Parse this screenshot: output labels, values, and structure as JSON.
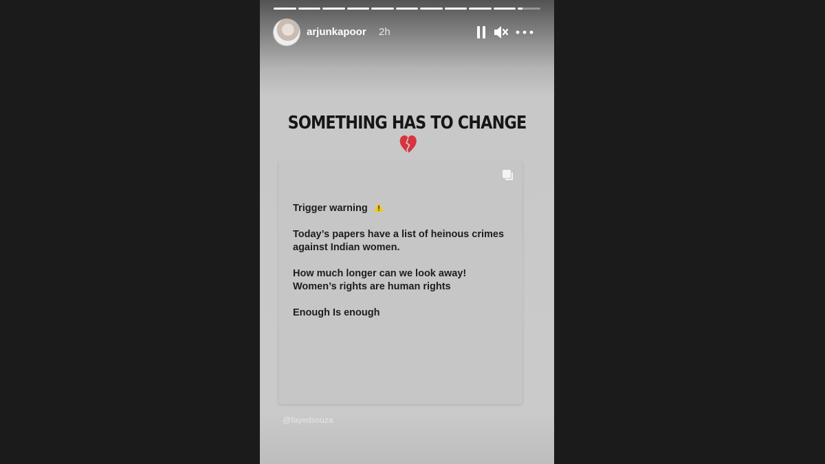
{
  "story": {
    "username": "arjunkapoor",
    "time_ago": "2h",
    "progress": {
      "segments": 11,
      "completed": 10,
      "current_fraction": 0.2
    },
    "headline": "SOMETHING HAS TO CHANGE",
    "headline_emoji": "broken-heart-icon",
    "card": {
      "line_trigger": "Trigger warning",
      "trigger_emoji": "warning-icon",
      "line_papers_1": "Today’s papers have a list of heinous crimes",
      "line_papers_2": "against Indian women.",
      "line_look_1": "How much longer can we look away!",
      "line_look_2": "Women’s rights are human rights",
      "line_enough": "Enough Is enough"
    },
    "credit": "@fayedsouza"
  },
  "icons": [
    "pause-icon",
    "mute-icon",
    "more-icon",
    "carousel-icon"
  ],
  "colors": {
    "background": "#1b1b1b",
    "heart": "#d8333f",
    "warning": "#f5c518"
  }
}
